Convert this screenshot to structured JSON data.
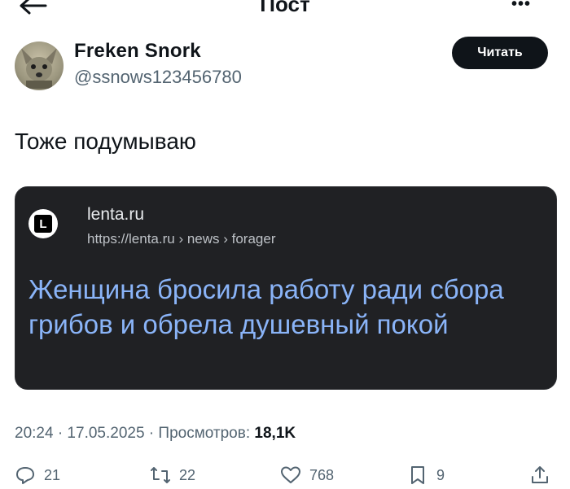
{
  "header": {
    "title": "Пост",
    "back_icon": "arrow-left-icon",
    "more_icon": "more-icon",
    "more_glyph": "•••"
  },
  "tweet": {
    "author_name": "Freken Snork",
    "author_handle": "@ssnows123456780",
    "read_button_label": "Читать",
    "text": "Тоже подумываю",
    "link_card": {
      "site_logo_letter": "L",
      "site_name": "lenta.ru",
      "site_url": "https://lenta.ru › news › forager",
      "headline": "Женщина бросила работу ради сбора грибов и обрела душевный покой"
    },
    "meta": {
      "time_date": "20:24 · 17.05.2025 · Просмотров: ",
      "views": "18,1K"
    },
    "actions": {
      "replies": "21",
      "retweets": "22",
      "likes": "768",
      "bookmarks": "9"
    }
  },
  "colors": {
    "card_bg": "#202124",
    "headline": "#8ab4f8",
    "button_bg": "#0f1419",
    "muted": "#536471"
  }
}
